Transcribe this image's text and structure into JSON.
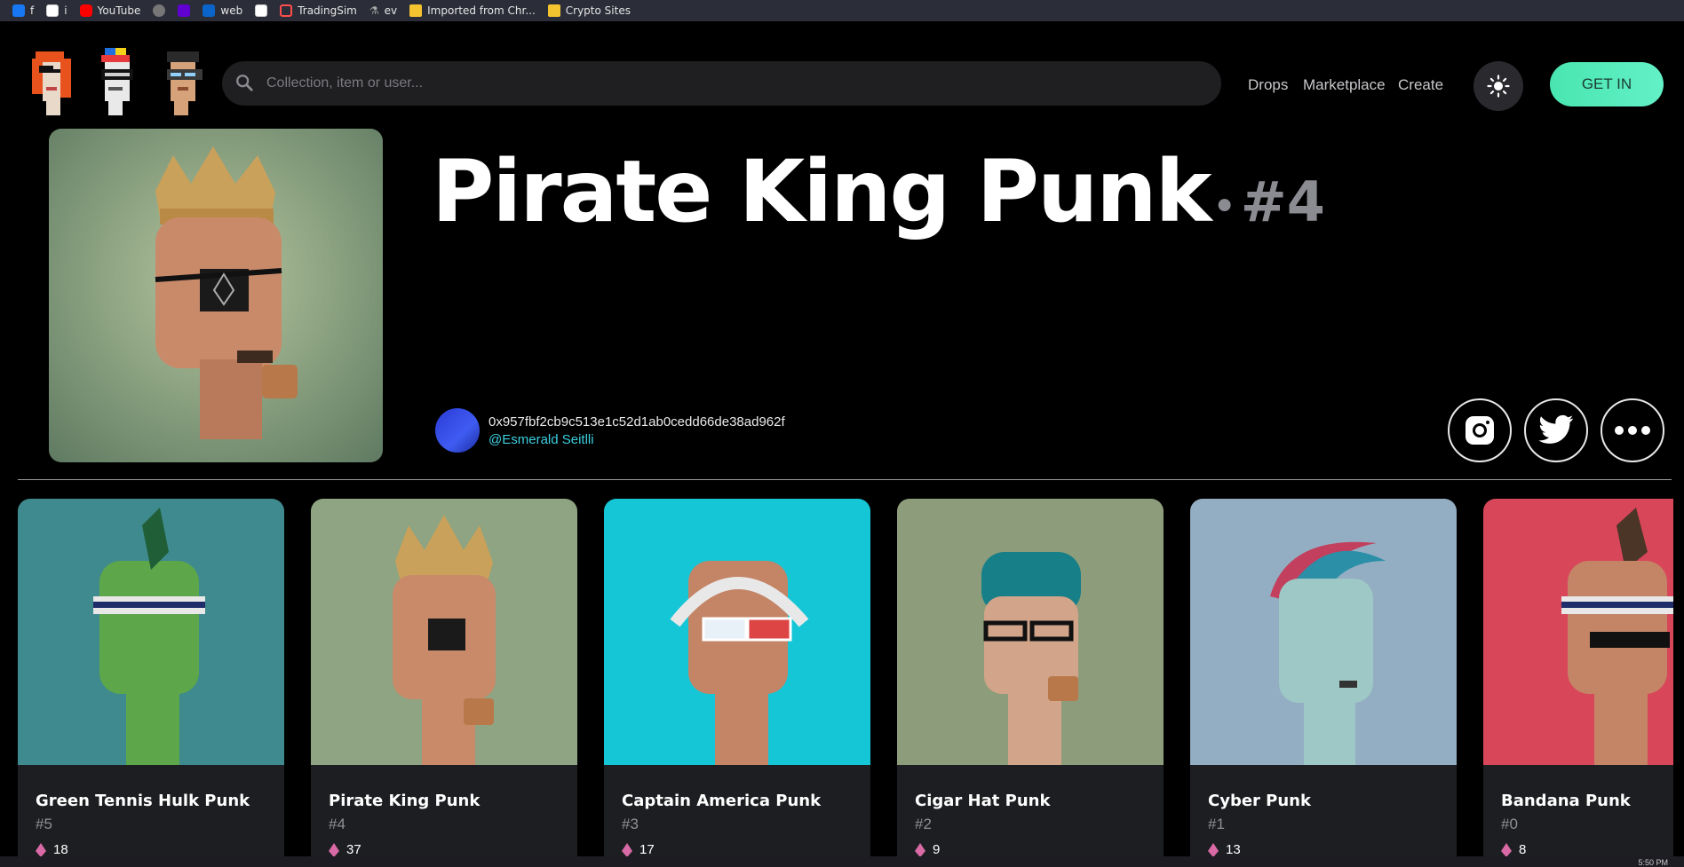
{
  "bookmarks": [
    {
      "label": "f",
      "icon": "facebook-icon"
    },
    {
      "label": "i",
      "icon": "document-icon"
    },
    {
      "label": "YouTube",
      "icon": "youtube-icon"
    },
    {
      "label": "",
      "icon": "globe-icon"
    },
    {
      "label": "",
      "icon": "yahoo-icon"
    },
    {
      "label": "web",
      "icon": "outlook-icon"
    },
    {
      "label": "",
      "icon": "document-icon"
    },
    {
      "label": "TradingSim",
      "icon": "tradingsim-icon"
    },
    {
      "label": "ev",
      "icon": "flask-icon"
    },
    {
      "label": "Imported from Chr...",
      "icon": "folder-icon"
    },
    {
      "label": "Crypto Sites",
      "icon": "folder-icon"
    }
  ],
  "header": {
    "search_placeholder": "Collection, item or user...",
    "nav": [
      "Drops",
      "Marketplace",
      "Create"
    ],
    "get_in_label": "GET IN"
  },
  "hero": {
    "title": "Pirate King Punk",
    "title_separator": "•",
    "number": "#4",
    "owner_address": "0x957fbf2cb9c513e1c52d1ab0cedd66de38ad962f",
    "owner_username": "@Esmerald Seitlli",
    "socials": [
      "instagram-icon",
      "twitter-icon",
      "more-icon"
    ]
  },
  "cards": [
    {
      "name": "Green Tennis Hulk Punk",
      "id": "#5",
      "likes": "18",
      "bg": "#3f8a8f",
      "skin": "#5da64a"
    },
    {
      "name": "Pirate King Punk",
      "id": "#4",
      "likes": "37",
      "bg": "#8ea482",
      "skin": "#c98a6a"
    },
    {
      "name": "Captain America Punk",
      "id": "#3",
      "likes": "17",
      "bg": "#14c6d6",
      "skin": "#c48466"
    },
    {
      "name": "Cigar Hat Punk",
      "id": "#2",
      "likes": "9",
      "bg": "#8d9c7a",
      "skin": "#d2a48a"
    },
    {
      "name": "Cyber Punk",
      "id": "#1",
      "likes": "13",
      "bg": "#93aec2",
      "skin": "#9ec8c6"
    },
    {
      "name": "Bandana Punk",
      "id": "#0",
      "likes": "8",
      "bg": "#d8465a",
      "skin": "#c48466"
    }
  ],
  "colors": {
    "accent": "#5aeebb",
    "link": "#3ccfe0",
    "like_icon": "#d86aa6"
  },
  "clock": "5:50 PM"
}
